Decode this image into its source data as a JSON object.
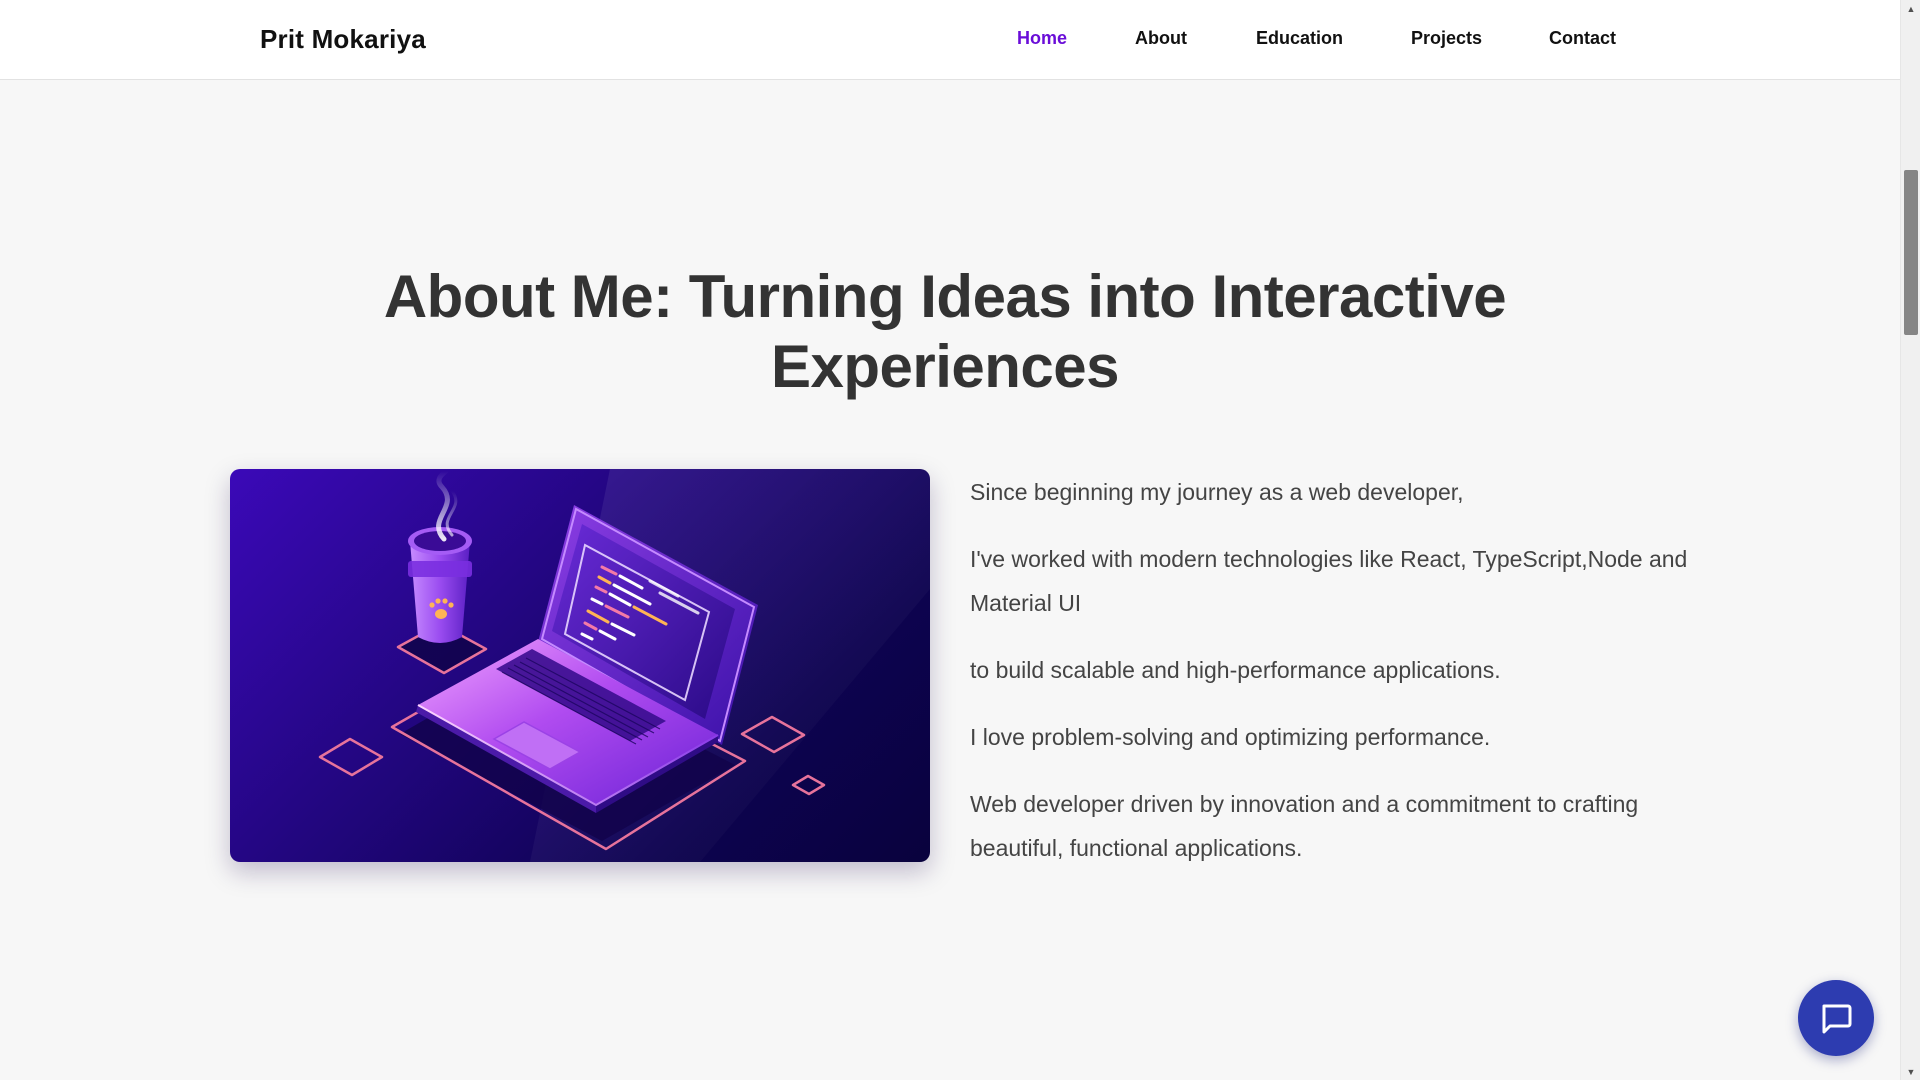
{
  "navbar": {
    "brand": "Prit Mokariya",
    "links": [
      {
        "label": "Home",
        "active": true
      },
      {
        "label": "About",
        "active": false
      },
      {
        "label": "Education",
        "active": false
      },
      {
        "label": "Projects",
        "active": false
      },
      {
        "label": "Contact",
        "active": false
      }
    ]
  },
  "about": {
    "heading_line1": "About Me: Turning Ideas into Interactive",
    "heading_line2": "Experiences",
    "paragraphs": [
      "Since beginning my journey as a web developer,",
      "I've worked with modern technologies like React, TypeScript,Node and Material UI",
      "to build scalable and high-performance applications.",
      "I love problem-solving and optimizing performance.",
      "Web developer driven by innovation and a commitment to crafting beautiful, functional applications."
    ],
    "illustration": "isometric-laptop-with-coffee-cup"
  },
  "chat": {
    "icon": "chat-bubble-icon"
  },
  "colors": {
    "accent": "#6a0dd8",
    "fab": "#2d3cb0",
    "heading": "#333333",
    "body_text": "#444444",
    "background": "#f7f7f7"
  }
}
